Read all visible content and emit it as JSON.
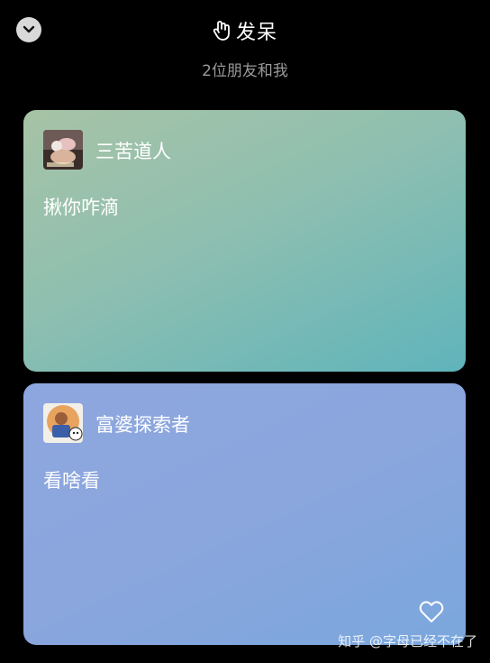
{
  "header": {
    "title": "发呆",
    "subtitle": "2位朋友和我"
  },
  "cards": [
    {
      "author": "三苦道人",
      "message": "揪你咋滴"
    },
    {
      "author": "富婆探索者",
      "message": "看啥看"
    }
  ],
  "watermark": "知乎 @字母已经不在了",
  "icons": {
    "collapse": "chevron-down-icon",
    "title": "hand-icon",
    "like": "heart-icon"
  },
  "colors": {
    "background": "#000000",
    "card1_gradient": [
      "#a7c3a6",
      "#5fb4bb"
    ],
    "card2_gradient": [
      "#8ea6df",
      "#7aa7dd"
    ],
    "subtitle": "#9a9a9a"
  }
}
